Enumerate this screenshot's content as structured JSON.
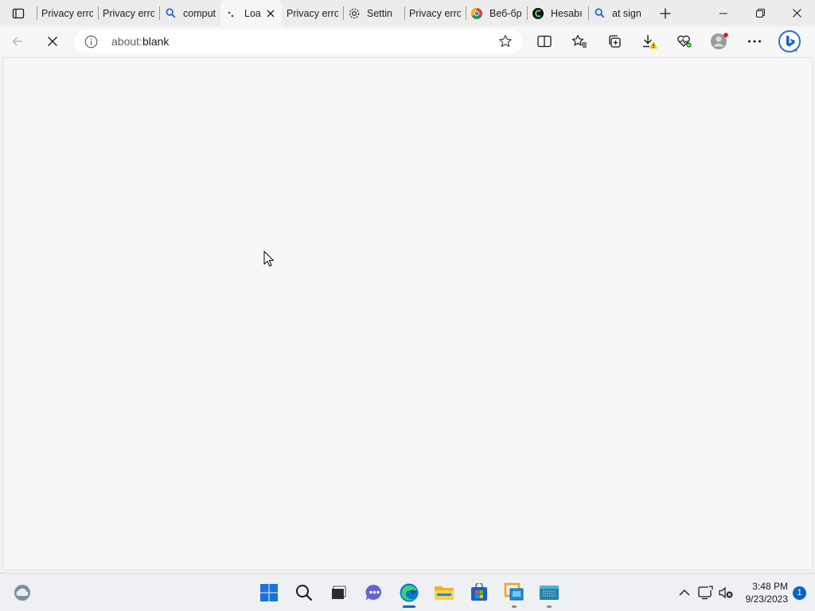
{
  "browser": {
    "tabs": [
      {
        "title": "Privacy error",
        "favicon": "none",
        "active": false
      },
      {
        "title": "Privacy error",
        "favicon": "none",
        "active": false
      },
      {
        "title": "comput",
        "favicon": "search-icon",
        "active": false
      },
      {
        "title": "Loa",
        "favicon": "loading-spinner-icon",
        "active": true
      },
      {
        "title": "Privacy erro",
        "favicon": "none",
        "active": false
      },
      {
        "title": "Settin",
        "favicon": "gear-icon",
        "active": false
      },
      {
        "title": "Privacy erro",
        "favicon": "none",
        "active": false
      },
      {
        "title": "Веб-бр",
        "favicon": "chrome-icon",
        "active": false
      },
      {
        "title": "Hesabı",
        "favicon": "green-logo-icon",
        "active": false
      },
      {
        "title": "at sign",
        "favicon": "search-icon",
        "active": false
      }
    ],
    "address": {
      "scheme": "about:",
      "rest": "blank"
    }
  },
  "taskbar": {
    "apps": [
      "start-icon",
      "search-icon",
      "file-icon",
      "chat-icon",
      "edge-icon",
      "file-explorer-icon",
      "store-icon",
      "remote-desktop-icon",
      "terminal-icon"
    ],
    "clock": {
      "time": "3:48 PM",
      "date": "9/23/2023"
    },
    "notification_count": "1"
  },
  "colors": {
    "accent": "#0067c0",
    "tabstrip_bg": "#ececec",
    "page_bg": "#f7f7f7",
    "alert_red": "#e81123",
    "warning_yellow": "#ffb900"
  }
}
